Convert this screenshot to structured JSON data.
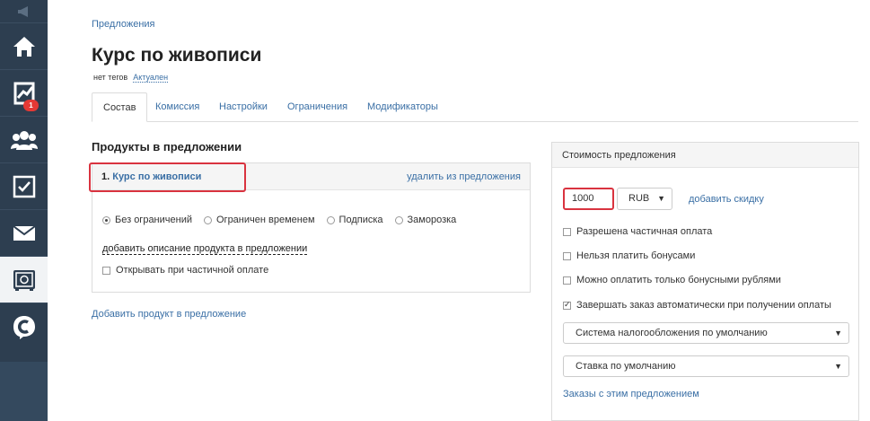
{
  "sidebar": {
    "icons": [
      "megaphone-icon",
      "home-icon",
      "chart-icon",
      "users-icon",
      "checkbox-icon",
      "mail-icon",
      "safe-icon",
      "logo-icon"
    ],
    "badge": "1"
  },
  "breadcrumb": "Предложения",
  "title": "Курс по живописи",
  "tags": {
    "label": "нет тегов",
    "status": "Актуален"
  },
  "tabs": [
    "Состав",
    "Комиссия",
    "Настройки",
    "Ограничения",
    "Модификаторы"
  ],
  "section_title": "Продукты в предложении",
  "product": {
    "number": "1.",
    "name": "Курс по живописи",
    "remove": "удалить из предложения",
    "radios": [
      "Без ограничений",
      "Ограничен временем",
      "Подписка",
      "Заморозка"
    ],
    "add_description": "добавить описание продукта в предложении",
    "open_partial": "Открывать при частичной оплате"
  },
  "add_product": "Добавить продукт в предложение",
  "price": {
    "header": "Стоимость предложения",
    "value": "1000",
    "currency": "RUB",
    "add_discount": "добавить скидку",
    "checks": [
      {
        "label": "Разрешена частичная оплата",
        "checked": false
      },
      {
        "label": "Нельзя платить бонусами",
        "checked": false
      },
      {
        "label": "Можно оплатить только бонусными рублями",
        "checked": false
      },
      {
        "label": "Завершать заказ автоматически при получении оплаты",
        "checked": true
      }
    ],
    "tax_select": "Система налогообложения по умолчанию",
    "rate_select": "Ставка по умолчанию",
    "orders_link": "Заказы с этим предложением"
  },
  "colors": {
    "sidebar": "#2d3e50",
    "link": "#3a6fa5",
    "highlight": "#d9333f"
  }
}
